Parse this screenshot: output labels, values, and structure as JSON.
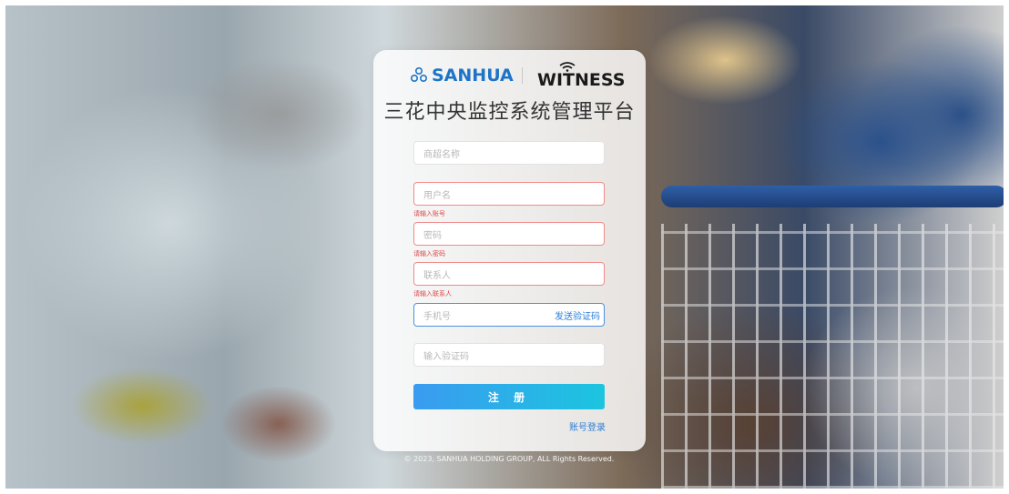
{
  "brand": {
    "sanhua": "SANHUA",
    "witness": "WITNESS"
  },
  "title": "三花中央监控系统管理平台",
  "form": {
    "store_name": {
      "placeholder": "商超名称"
    },
    "username": {
      "placeholder": "用户名",
      "error": "请输入账号"
    },
    "password": {
      "placeholder": "密码",
      "error": "请输入密码"
    },
    "contact": {
      "placeholder": "联系人",
      "error": "请输入联系人"
    },
    "phone": {
      "placeholder": "手机号",
      "send_code": "发送验证码"
    },
    "code": {
      "placeholder": "输入验证码"
    },
    "submit": "注 册",
    "login_link": "账号登录"
  },
  "footer": "© 2023, SANHUA HOLDING GROUP, ALL Rights Reserved.",
  "colors": {
    "accent": "#2d7fd6",
    "error": "#e04848",
    "button_start": "#3a9bf0",
    "button_end": "#1cc5e0"
  },
  "icons": {
    "sanhua_logo": "sanhua-logo-icon",
    "witness_wifi": "wifi-icon"
  }
}
